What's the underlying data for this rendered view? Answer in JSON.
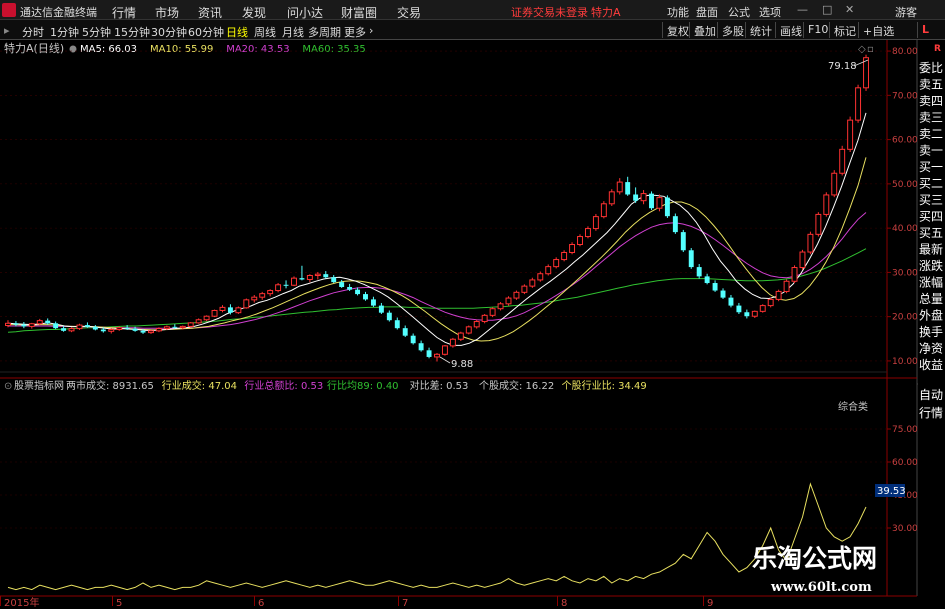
{
  "menubar": {
    "app_name": "通达信金融终端",
    "menus": [
      "行情",
      "市场",
      "资讯",
      "发现",
      "问小达",
      "财富圈",
      "交易"
    ],
    "login_status": "证券交易未登录",
    "stock_title": "特力A",
    "right_items": [
      "功能",
      "盘面",
      "公式",
      "选项"
    ],
    "user": "游客"
  },
  "toolbar": {
    "periods": [
      "分时",
      "1分钟",
      "5分钟",
      "15分钟",
      "30分钟",
      "60分钟",
      "日线",
      "周线",
      "月线",
      "多周期",
      "更多"
    ],
    "active_period": "日线",
    "tools": [
      "复权",
      "叠加",
      "多股",
      "统计",
      "画线",
      "F10",
      "标记",
      "+自选"
    ],
    "sidebar_tag": "L"
  },
  "chart_data": [
    {
      "type": "candlestick",
      "title": "特力A(日线)",
      "ylim": [
        7.5,
        82.5
      ],
      "yticks": [
        10,
        20,
        30,
        40,
        50,
        60,
        70,
        80
      ],
      "price_labels": {
        "high": "79.18",
        "low": "9.88"
      },
      "legend": [
        {
          "name": "MA5",
          "value": "66.03",
          "color": "#ffffff"
        },
        {
          "name": "MA10",
          "value": "55.99",
          "color": "#e8e060"
        },
        {
          "name": "MA20",
          "value": "43.53",
          "color": "#d040d0"
        },
        {
          "name": "MA60",
          "value": "35.35",
          "color": "#30c030"
        }
      ],
      "candles": [
        [
          18,
          19.2,
          17.6,
          18.5
        ],
        [
          18.5,
          19,
          17.8,
          18.2
        ],
        [
          18.2,
          18.8,
          17.4,
          17.8
        ],
        [
          17.8,
          18.6,
          17.3,
          18.4
        ],
        [
          18.4,
          19.5,
          18.1,
          19.1
        ],
        [
          19.1,
          19.6,
          18.2,
          18.5
        ],
        [
          18.5,
          18.9,
          17.2,
          17.4
        ],
        [
          17.4,
          17.9,
          16.6,
          16.8
        ],
        [
          16.8,
          17.6,
          16.5,
          17.3
        ],
        [
          17.3,
          18.4,
          17,
          18.1
        ],
        [
          18.1,
          18.7,
          17.5,
          17.7
        ],
        [
          17.7,
          18.1,
          16.9,
          17.1
        ],
        [
          17.1,
          17.6,
          16.4,
          16.7
        ],
        [
          16.7,
          17.4,
          16.2,
          17.1
        ],
        [
          17.1,
          17.8,
          16.8,
          17.5
        ],
        [
          17.5,
          18.1,
          17,
          17.3
        ],
        [
          17.3,
          17.7,
          16.6,
          16.8
        ],
        [
          16.8,
          17.2,
          16.1,
          16.4
        ],
        [
          16.4,
          17,
          16.1,
          16.8
        ],
        [
          16.8,
          17.6,
          16.5,
          17.3
        ],
        [
          17.3,
          18,
          17,
          17.7
        ],
        [
          17.7,
          18.3,
          17.3,
          17.5
        ],
        [
          17.5,
          18,
          17.1,
          17.8
        ],
        [
          17.8,
          18.8,
          17.6,
          18.6
        ],
        [
          18.6,
          19.6,
          18.4,
          19.3
        ],
        [
          19.3,
          20.3,
          19,
          20.1
        ],
        [
          20.1,
          21.6,
          19.9,
          21.4
        ],
        [
          21.4,
          22.6,
          21,
          22.1
        ],
        [
          22.1,
          22.8,
          20.5,
          20.9
        ],
        [
          20.9,
          22.3,
          20.6,
          22
        ],
        [
          22,
          24.1,
          21.8,
          23.8
        ],
        [
          23.8,
          24.9,
          23.2,
          24.4
        ],
        [
          24.4,
          25.6,
          23.8,
          25.2
        ],
        [
          25.2,
          26.2,
          24.6,
          25.9
        ],
        [
          25.9,
          27.6,
          25.5,
          27.2
        ],
        [
          27.2,
          28.2,
          26.4,
          27.1
        ],
        [
          27.1,
          29.1,
          26.9,
          28.7
        ],
        [
          28.7,
          31.5,
          28.2,
          28.4
        ],
        [
          28.4,
          29.6,
          27.8,
          29.3
        ],
        [
          29.3,
          30.1,
          28.4,
          29.6
        ],
        [
          29.6,
          30.3,
          28.6,
          28.9
        ],
        [
          28.9,
          29.4,
          27.6,
          27.8
        ],
        [
          27.8,
          28.3,
          26.5,
          26.7
        ],
        [
          26.7,
          27.4,
          25.8,
          26.1
        ],
        [
          26.1,
          26.6,
          24.8,
          25.1
        ],
        [
          25.1,
          25.6,
          23.6,
          23.9
        ],
        [
          23.9,
          24.5,
          22.2,
          22.5
        ],
        [
          22.5,
          23.1,
          20.6,
          20.9
        ],
        [
          20.9,
          21.4,
          18.9,
          19.2
        ],
        [
          19.2,
          19.8,
          17.1,
          17.4
        ],
        [
          17.4,
          18,
          15.4,
          15.7
        ],
        [
          15.7,
          16.2,
          13.7,
          14
        ],
        [
          14,
          14.6,
          12.1,
          12.4
        ],
        [
          12.4,
          13,
          10.6,
          10.9
        ],
        [
          10.9,
          11.8,
          9.88,
          11.5
        ],
        [
          11.5,
          13.6,
          11.2,
          13.4
        ],
        [
          13.4,
          15.2,
          13,
          14.9
        ],
        [
          14.9,
          16.6,
          14.5,
          16.3
        ],
        [
          16.3,
          18,
          16,
          17.7
        ],
        [
          17.7,
          19.3,
          17.3,
          18.9
        ],
        [
          18.9,
          20.6,
          18.5,
          20.3
        ],
        [
          20.3,
          22.1,
          19.9,
          21.8
        ],
        [
          21.8,
          23.3,
          21.4,
          22.9
        ],
        [
          22.9,
          24.6,
          22.5,
          24.2
        ],
        [
          24.2,
          25.9,
          23.8,
          25.5
        ],
        [
          25.5,
          27.3,
          25.1,
          26.9
        ],
        [
          26.9,
          28.8,
          26.5,
          28.3
        ],
        [
          28.3,
          30.2,
          27.9,
          29.7
        ],
        [
          29.7,
          31.8,
          29.3,
          31.3
        ],
        [
          31.3,
          33.4,
          30.9,
          32.9
        ],
        [
          32.9,
          35,
          32.5,
          34.5
        ],
        [
          34.5,
          36.8,
          34.1,
          36.3
        ],
        [
          36.3,
          38.6,
          35.9,
          38.1
        ],
        [
          38.1,
          40.4,
          37.7,
          39.9
        ],
        [
          39.9,
          43.2,
          39.4,
          42.6
        ],
        [
          42.6,
          46.1,
          42.2,
          45.5
        ],
        [
          45.5,
          48.8,
          45,
          48.2
        ],
        [
          48.2,
          51.3,
          47.6,
          50.4
        ],
        [
          50.4,
          51.6,
          47.3,
          47.6
        ],
        [
          47.6,
          49.2,
          45.7,
          46.2
        ],
        [
          46.2,
          48.6,
          45.4,
          47.8
        ],
        [
          47.8,
          48.3,
          44.1,
          44.5
        ],
        [
          44.5,
          47.6,
          43.8,
          46.9
        ],
        [
          46.9,
          47.4,
          42.3,
          42.7
        ],
        [
          42.7,
          43.3,
          38.7,
          39.1
        ],
        [
          39.1,
          39.6,
          34.6,
          35
        ],
        [
          35,
          35.5,
          30.8,
          31.2
        ],
        [
          31.2,
          31.9,
          28.6,
          29.1
        ],
        [
          29.1,
          29.7,
          27.3,
          27.6
        ],
        [
          27.6,
          28.2,
          25.6,
          25.9
        ],
        [
          25.9,
          26.4,
          24,
          24.3
        ],
        [
          24.3,
          24.9,
          22.1,
          22.5
        ],
        [
          22.5,
          23.1,
          20.6,
          21
        ],
        [
          21,
          21.6,
          19.6,
          20.1
        ],
        [
          20.1,
          21.4,
          19.7,
          21.2
        ],
        [
          21.2,
          22.8,
          20.9,
          22.5
        ],
        [
          22.5,
          24.3,
          22.1,
          23.9
        ],
        [
          23.9,
          26.1,
          23.5,
          25.7
        ],
        [
          25.7,
          28.4,
          25.3,
          28
        ],
        [
          28,
          31.6,
          27.6,
          31.1
        ],
        [
          31.1,
          35.1,
          30.6,
          34.6
        ],
        [
          34.6,
          39.2,
          34.1,
          38.6
        ],
        [
          38.6,
          43.6,
          38.1,
          43.1
        ],
        [
          43.1,
          48.1,
          42.6,
          47.5
        ],
        [
          47.5,
          53.1,
          47,
          52.4
        ],
        [
          52.4,
          58.6,
          51.9,
          57.8
        ],
        [
          57.8,
          65.2,
          57.2,
          64.4
        ],
        [
          64.4,
          72.4,
          63.8,
          71.7
        ],
        [
          71.7,
          79.18,
          71,
          78.5
        ]
      ],
      "ma60": [
        16.5,
        16.6,
        16.8,
        16.9,
        17,
        17.1,
        17.1,
        17.2,
        17.3,
        17.4,
        17.5,
        17.5,
        17.6,
        17.7,
        17.8,
        17.9,
        17.9,
        18,
        18.1,
        18.2,
        18.3,
        18.4,
        18.5,
        18.6,
        18.7,
        18.9,
        19,
        19.2,
        19.4,
        19.5,
        19.7,
        19.9,
        20,
        20.2,
        20.4,
        20.6,
        20.8,
        21,
        21.1,
        21.3,
        21.5,
        21.6,
        21.8,
        21.9,
        22,
        22.1,
        22.1,
        22.2,
        22.2,
        22.2,
        22.1,
        22.1,
        22,
        21.9,
        21.9,
        21.9,
        21.9,
        21.9,
        21.9,
        22,
        22.1,
        22.2,
        22.3,
        22.5,
        22.6,
        22.8,
        23,
        23.2,
        23.5,
        23.8,
        24.1,
        24.4,
        24.8,
        25.2,
        25.6,
        26,
        26.4,
        26.8,
        27.2,
        27.5,
        27.8,
        28.1,
        28.3,
        28.5,
        28.6,
        28.6,
        28.6,
        28.6,
        28.5,
        28.4,
        28.3,
        28.2,
        28.1,
        28.1,
        28.1,
        28.2,
        28.3,
        28.5,
        28.8,
        29.2,
        29.7,
        30.3,
        31,
        31.8,
        32.6,
        33.5,
        34.4,
        35.35
      ],
      "ma20": [
        17.9,
        17.9,
        17.9,
        17.9,
        17.9,
        17.9,
        17.8,
        17.8,
        17.8,
        17.7,
        17.7,
        17.6,
        17.6,
        17.5,
        17.5,
        17.5,
        17.5,
        17.4,
        17.4,
        17.4,
        17.4,
        17.4,
        17.4,
        17.4,
        17.5,
        17.6,
        17.8,
        18,
        18.2,
        18.5,
        18.9,
        19.3,
        19.8,
        20.3,
        20.9,
        21.5,
        22.2,
        22.9,
        23.6,
        24.2,
        24.8,
        25.4,
        25.8,
        26.2,
        26.5,
        26.6,
        26.6,
        26.4,
        26.1,
        25.6,
        25,
        24.3,
        23.4,
        22.6,
        21.8,
        21,
        20.4,
        19.9,
        19.5,
        19.3,
        19.2,
        19.2,
        19.4,
        19.7,
        20.2,
        20.9,
        21.8,
        22.7,
        23.7,
        24.8,
        25.9,
        27.1,
        28.4,
        29.8,
        31.3,
        32.8,
        34.3,
        35.8,
        37.1,
        38.3,
        39.3,
        40.2,
        40.8,
        41.1,
        41.2,
        40.9,
        40.4,
        39.6,
        38.6,
        37.4,
        36.1,
        34.7,
        33.3,
        32,
        30.9,
        29.9,
        29.2,
        28.9,
        28.8,
        29.1,
        29.7,
        30.7,
        32,
        33.6,
        35.5,
        37.6,
        39.9,
        42,
        43.53
      ],
      "ma10": [
        18.2,
        18.2,
        18.1,
        18.1,
        18.2,
        18.2,
        18.1,
        17.9,
        17.8,
        17.8,
        17.8,
        17.7,
        17.6,
        17.5,
        17.4,
        17.3,
        17.2,
        17.1,
        17,
        17,
        17.1,
        17.2,
        17.3,
        17.4,
        17.6,
        17.8,
        18.2,
        18.6,
        19.1,
        19.5,
        20,
        20.6,
        21.3,
        22,
        22.8,
        23.6,
        24.4,
        25.2,
        25.9,
        26.6,
        27.2,
        27.7,
        28,
        28.1,
        28,
        27.7,
        27.3,
        26.6,
        25.8,
        24.9,
        23.8,
        22.5,
        21.2,
        19.8,
        18.4,
        17.2,
        16.1,
        15.3,
        14.7,
        14.5,
        14.6,
        15,
        15.7,
        16.6,
        17.8,
        19.1,
        20.5,
        22,
        23.5,
        25.1,
        26.7,
        28.3,
        30,
        31.7,
        33.4,
        35.2,
        37.1,
        39.1,
        40.8,
        42.3,
        43.5,
        44.5,
        45.4,
        45.9,
        45.9,
        45.3,
        44.2,
        42.6,
        40.6,
        38.4,
        35.9,
        33.3,
        30.9,
        28.6,
        26.6,
        25,
        24,
        23.7,
        24.1,
        25.2,
        27,
        29.4,
        32.3,
        35.8,
        39.9,
        44.6,
        49.6,
        55.99
      ],
      "ma5": [
        18.5,
        18.4,
        18.3,
        18.2,
        18.4,
        18.6,
        18.3,
        17.9,
        17.7,
        17.8,
        17.8,
        17.6,
        17.4,
        17.2,
        17.3,
        17.2,
        17.1,
        16.9,
        16.9,
        17,
        17.2,
        17.4,
        17.5,
        17.8,
        18.3,
        18.9,
        19.6,
        20.6,
        21.3,
        21.9,
        22.4,
        23.2,
        23.7,
        24.4,
        25.2,
        25.9,
        26.9,
        27.4,
        28,
        28.5,
        28.8,
        28.9,
        28.5,
        28,
        27.3,
        26.4,
        25.5,
        24.4,
        23,
        21.5,
        20,
        18.4,
        16.8,
        15.3,
        14.2,
        13.5,
        13.5,
        14,
        14.9,
        16.4,
        17.9,
        19.4,
        20.9,
        22.4,
        23.9,
        25.3,
        26.7,
        28,
        29.4,
        30.8,
        32.4,
        33.9,
        35.6,
        37.3,
        39,
        41,
        43.2,
        45.4,
        46.7,
        47.4,
        47.4,
        47.2,
        46.2,
        45.2,
        43.6,
        41.4,
        38.6,
        35.4,
        32.6,
        30.4,
        28,
        26.3,
        25,
        24.2,
        24.1,
        24.6,
        25.7,
        27.4,
        29.9,
        33,
        36.4,
        40.4,
        44.8,
        49.5,
        54.7,
        59.8,
        66.03
      ]
    },
    {
      "type": "line",
      "title": "股票指标网",
      "subtitle": "综合类",
      "ylim": [
        0,
        90
      ],
      "yticks": [
        30,
        45,
        60,
        75
      ],
      "current_value": "39.53",
      "stats": [
        {
          "label": "两市成交",
          "value": "8931.65",
          "color": "#c8c8c8"
        },
        {
          "label": "行业成交",
          "value": "47.04",
          "color": "#e8e060"
        },
        {
          "label": "行业总额比",
          "value": "0.53",
          "color": "#d040d0"
        },
        {
          "label": "行比均89",
          "value": "0.40",
          "color": "#30c030"
        },
        {
          "label": "对比差",
          "value": "0.53",
          "color": "#c8c8c8"
        },
        {
          "label": "个股成交",
          "value": "16.22",
          "color": "#c8c8c8"
        },
        {
          "label": "个股行业比",
          "value": "34.49",
          "color": "#e8e060"
        }
      ],
      "values": [
        3,
        2,
        3,
        2,
        4,
        3,
        2,
        3,
        4,
        3,
        2,
        3,
        3,
        4,
        3,
        2,
        3,
        5,
        3,
        4,
        3,
        2,
        3,
        3,
        4,
        6,
        5,
        4,
        3,
        4,
        5,
        4,
        3,
        4,
        5,
        6,
        5,
        4,
        3,
        4,
        3,
        4,
        5,
        6,
        5,
        4,
        4,
        5,
        6,
        5,
        4,
        3,
        4,
        3,
        3,
        4,
        5,
        4,
        3,
        4,
        3,
        4,
        5,
        7,
        5,
        4,
        5,
        6,
        7,
        6,
        8,
        6,
        5,
        7,
        6,
        8,
        5,
        7,
        6,
        8,
        7,
        9,
        10,
        12,
        14,
        18,
        16,
        22,
        28,
        24,
        18,
        14,
        10,
        12,
        16,
        22,
        30,
        20,
        15,
        25,
        35,
        50,
        40,
        30,
        26,
        24,
        26,
        32,
        39.53
      ]
    }
  ],
  "x_axis": {
    "labels": [
      "2015年",
      "5",
      "6",
      "7",
      "8",
      "9"
    ]
  },
  "right_panel": {
    "top_items": [
      "委比",
      "卖五",
      "卖四",
      "卖三",
      "卖二",
      "卖一",
      "买一",
      "买二",
      "买三",
      "买四",
      "买五",
      "最新",
      "涨跌",
      "涨幅",
      "总量",
      "外盘",
      "换手",
      "净资",
      "收益"
    ],
    "bottom_items": [
      "自动",
      "行情"
    ]
  },
  "watermark": {
    "title": "乐淘公式网",
    "url": "www.60lt.com"
  }
}
